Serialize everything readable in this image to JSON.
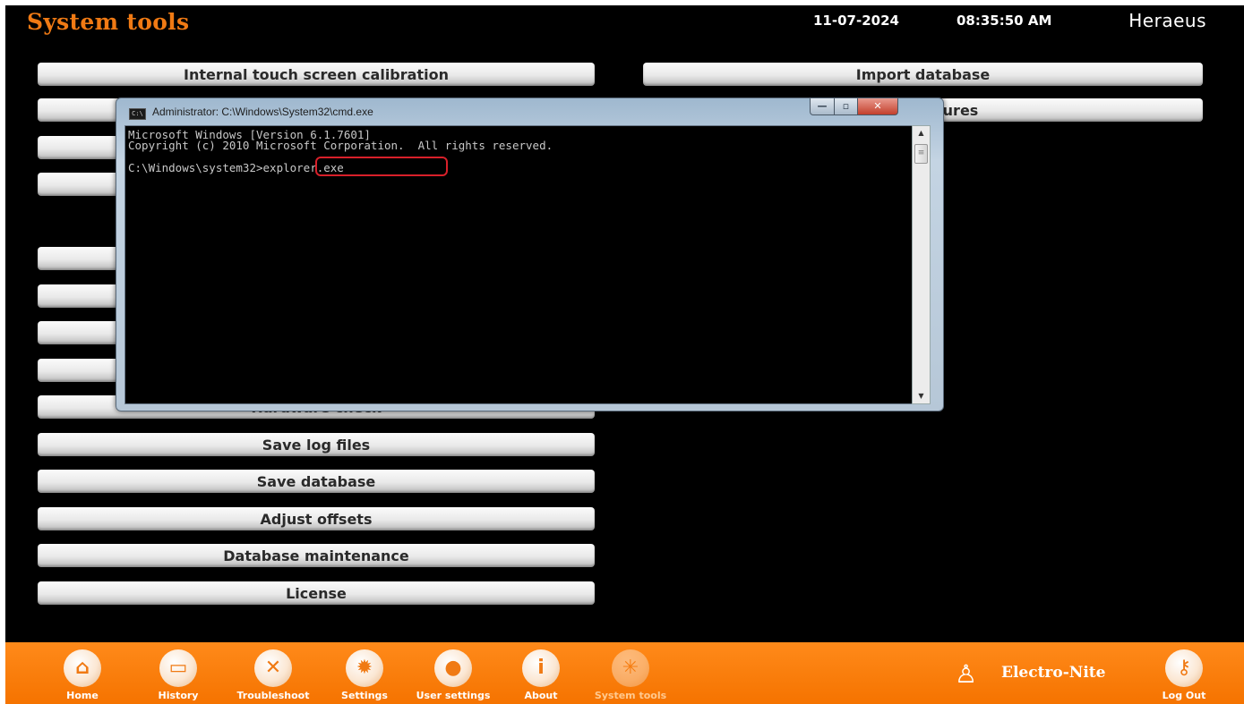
{
  "header": {
    "title": "System tools",
    "date": "11-07-2024",
    "time": "08:35:50 AM",
    "brand": "Heraeus"
  },
  "left_buttons": [
    "Internal touch screen calibration",
    "",
    "",
    "",
    "",
    "",
    "",
    "",
    "Hardware check",
    "Save log files",
    "Save database",
    "Adjust offsets",
    "Database maintenance",
    "License"
  ],
  "right_buttons": [
    "Import database",
    "stic features"
  ],
  "cmd": {
    "title": "Administrator: C:\\Windows\\System32\\cmd.exe",
    "icon_text": "C:\\",
    "line1": "Microsoft Windows [Version 6.1.7601]",
    "line2": "Copyright (c) 2010 Microsoft Corporation.  All rights reserved.",
    "prompt": "C:\\Windows\\system32",
    "command": ">explorer.exe",
    "min_glyph": "—",
    "max_glyph": "▫",
    "close_glyph": "✕"
  },
  "footer": {
    "nav": [
      {
        "label": "Home",
        "icon": "home-icon",
        "glyph": "⌂"
      },
      {
        "label": "History",
        "icon": "folder-icon",
        "glyph": "▭"
      },
      {
        "label": "Troubleshoot",
        "icon": "tools-icon",
        "glyph": "✕"
      },
      {
        "label": "Settings",
        "icon": "gear-icon",
        "glyph": "✹"
      },
      {
        "label": "User settings",
        "icon": "user-gear-icon",
        "glyph": "●"
      },
      {
        "label": "About",
        "icon": "info-icon",
        "glyph": "i"
      },
      {
        "label": "System tools",
        "icon": "sparkle-icon",
        "glyph": "✳"
      }
    ],
    "logo_text": "Electro-Nite",
    "logout_label": "Log Out",
    "logout_glyph": "⚷",
    "colors": {
      "bar": "#f57300",
      "accent": "#f07a14"
    }
  }
}
